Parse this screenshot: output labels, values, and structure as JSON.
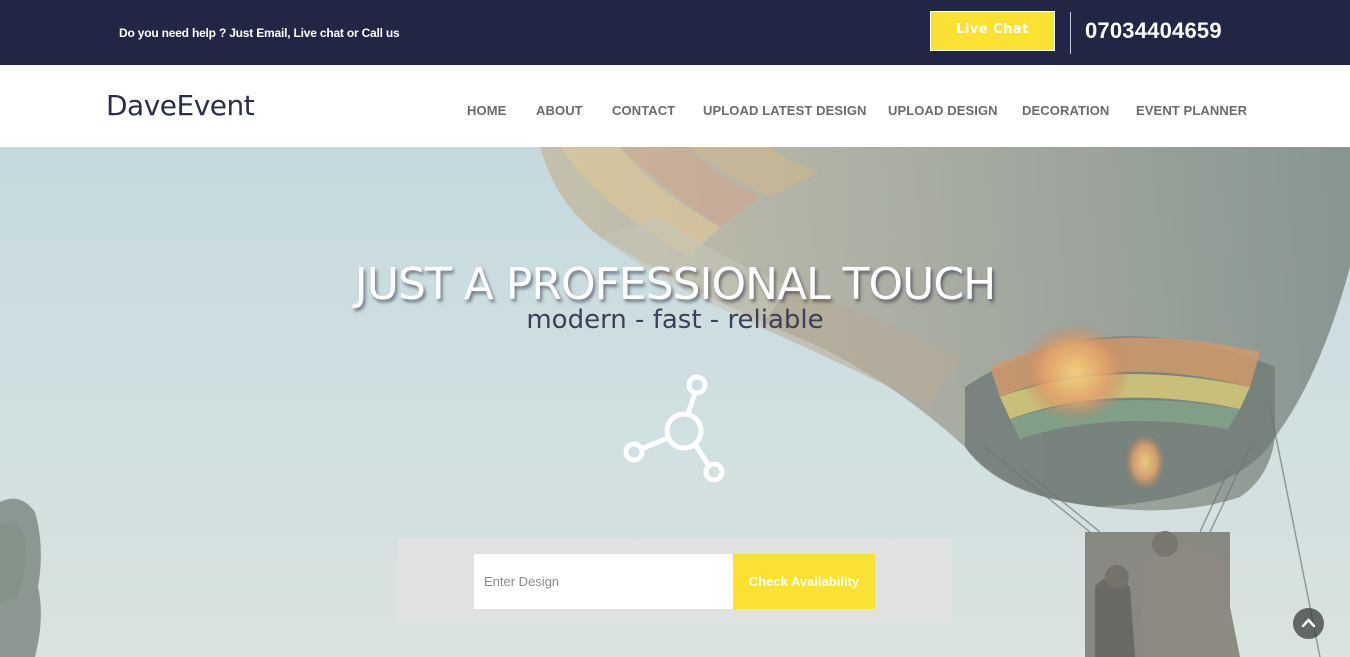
{
  "topbar": {
    "help_text": "Do you need help ? Just Email, Live chat or Call us",
    "live_chat_label": "Live Chat",
    "phone": "07034404659"
  },
  "header": {
    "logo": "DaveEvent",
    "nav": [
      {
        "label": "HOME"
      },
      {
        "label": "ABOUT"
      },
      {
        "label": "CONTACT"
      },
      {
        "label": "UPLOAD LATEST DESIGN"
      },
      {
        "label": "UPLOAD DESIGN"
      },
      {
        "label": "DECORATION"
      },
      {
        "label": "EVENT PLANNER"
      }
    ]
  },
  "hero": {
    "headline": "JUST A PROFESSIONAL TOUCH",
    "tagline": "modern - fast - reliable",
    "icon": "share-nodes-icon",
    "search_placeholder": "Enter Design",
    "check_label": "Check Availability"
  },
  "colors": {
    "topbar_bg": "#222544",
    "accent": "#fbe131",
    "nav_text": "#6b6b6b"
  },
  "scroll_top_icon": "chevron-up-icon"
}
